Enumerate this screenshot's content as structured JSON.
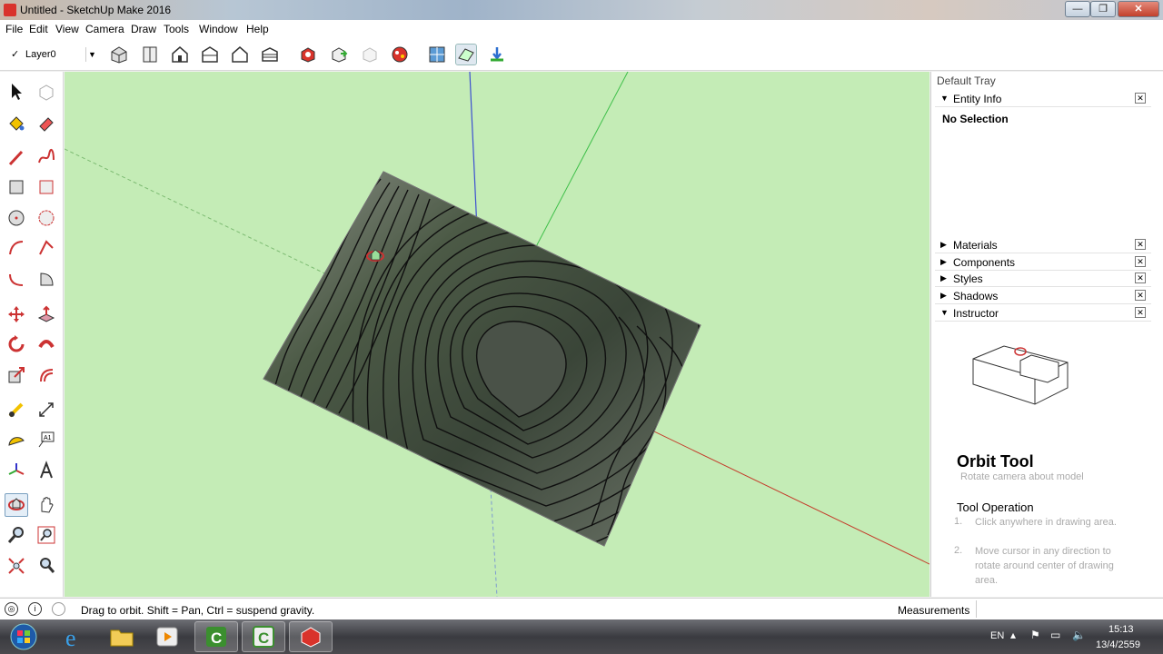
{
  "window": {
    "title": "Untitled - SketchUp Make 2016",
    "min": "—",
    "max": "❐",
    "close": "✕"
  },
  "menu": {
    "items": [
      "File",
      "Edit",
      "View",
      "Camera",
      "Draw",
      "Tools",
      "Window",
      "Help"
    ]
  },
  "toolbar": {
    "layer": "Layer0"
  },
  "tray": {
    "title": "Default Tray",
    "entity_info": "Entity Info",
    "no_selection": "No Selection",
    "panels": [
      "Materials",
      "Components",
      "Styles",
      "Shadows",
      "Instructor"
    ],
    "instructor": {
      "tool_name": "Orbit Tool",
      "tool_desc": "Rotate camera about model",
      "op_title": "Tool Operation",
      "steps": [
        "Click anywhere in drawing area.",
        "Move cursor in any direction to rotate around center of drawing area."
      ],
      "step_nums": [
        "1.",
        "2."
      ]
    }
  },
  "status": {
    "text": "Drag to orbit. Shift = Pan, Ctrl = suspend gravity.",
    "measurements_label": "Measurements"
  },
  "taskbar": {
    "lang": "EN",
    "time": "15:13",
    "date": "13/4/2559"
  },
  "colors": {
    "viewport_bg": "#c4ecb6",
    "axis_red": "#c43b2a",
    "axis_green": "#3fbf4a",
    "axis_blue": "#3c4fd0"
  }
}
